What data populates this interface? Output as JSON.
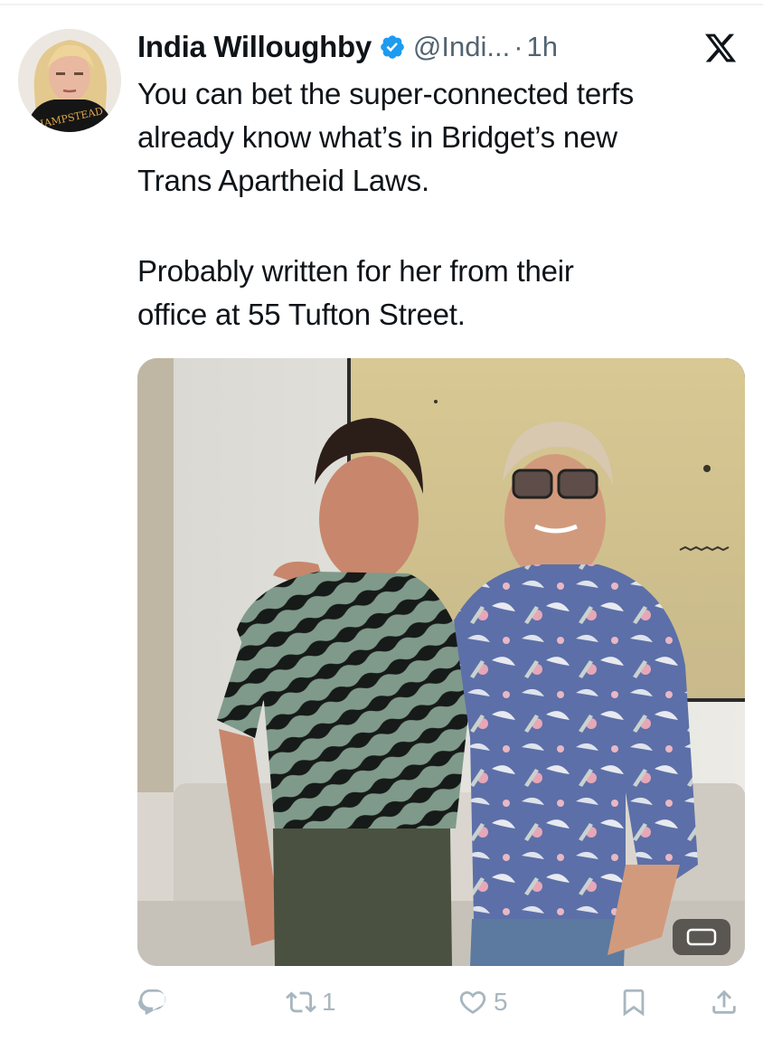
{
  "user": {
    "name": "India Willoughby",
    "handle": "@Indi...",
    "separator": "·",
    "time": "1h",
    "avatar_shirt_text": "HAMPSTEAD"
  },
  "post": {
    "paragraphs": [
      [
        "You can bet the super-connected terfs",
        "already know what’s in Bridget’s new",
        "Trans Apartheid Laws."
      ],
      [
        "Probably written for her from their",
        "office at 55 Tufton Street."
      ]
    ]
  },
  "actions": {
    "reply": {
      "icon": "reply-icon",
      "count": ""
    },
    "repost": {
      "icon": "repost-icon",
      "count": "1"
    },
    "like": {
      "icon": "heart-icon",
      "count": "5"
    },
    "bookmark": {
      "icon": "bookmark-icon"
    },
    "share": {
      "icon": "share-icon"
    }
  },
  "colors": {
    "text": "#0f1419",
    "secondary": "#536471",
    "verified": "#1d9bf0",
    "action_icons": "#a8b6bf"
  }
}
